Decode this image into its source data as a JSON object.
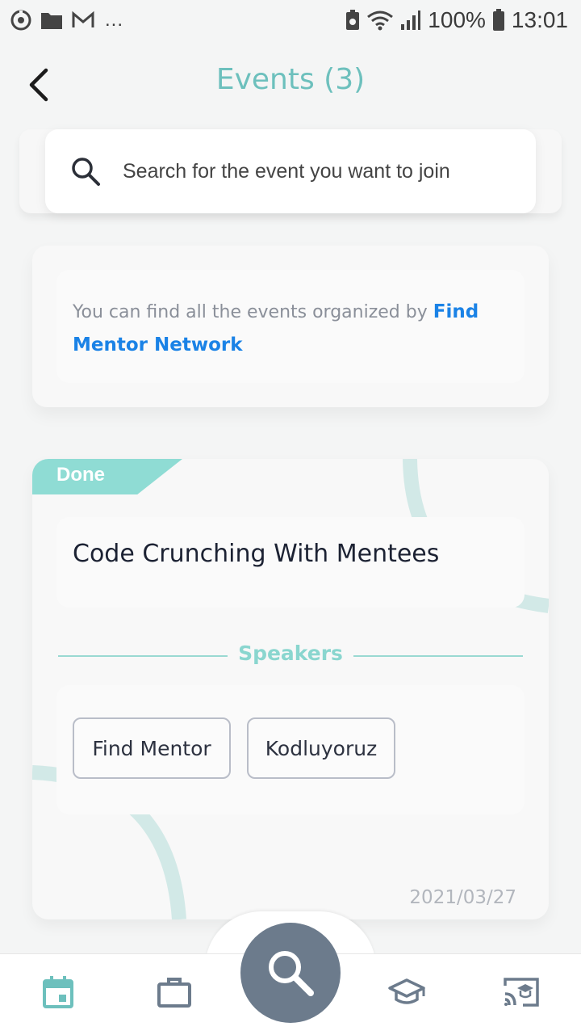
{
  "status_bar": {
    "battery": "100%",
    "time": "13:01",
    "overflow": "..."
  },
  "header": {
    "title": "Events (3)"
  },
  "search": {
    "placeholder": "Search for the event you want to join"
  },
  "info": {
    "text": "You can find all the events organized by ",
    "link": "Find Mentor Network"
  },
  "event": {
    "status": "Done",
    "title": "Code Crunching With Mentees",
    "speakers_label": "Speakers",
    "speakers": [
      "Find Mentor",
      "Kodluyoruz"
    ],
    "date": "2021/03/27"
  },
  "bottom_nav": {
    "items": [
      "calendar-icon",
      "briefcase-icon",
      "search-icon",
      "graduation-cap-icon",
      "cast-icon"
    ],
    "active": "calendar-icon"
  },
  "colors": {
    "accent": "#6dc0bd",
    "link": "#1a82e6",
    "done_tag": "#8fdcd4",
    "nav_center": "#6c7b8c"
  }
}
